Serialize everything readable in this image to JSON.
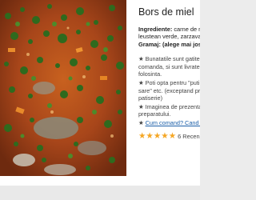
{
  "product": {
    "title": "Bors de miel",
    "ingredients_label": "Ingrediente:",
    "ingredients_line1": " carne de mie",
    "ingredients_line2": "leustean verde, zarzavat, c",
    "gramaj_label": "Gramaj: (alege mai jos)"
  },
  "notes": [
    {
      "lines": [
        "Bunatatile sunt gatite sp",
        "comanda, si sunt livrate in",
        "folosinta."
      ]
    },
    {
      "lines": [
        "Poti opta pentru \"putin s",
        "sare\" etc. (exceptand prod",
        "patiserie)"
      ]
    },
    {
      "lines": [
        "Imaginea de prezentare",
        "preparatului."
      ]
    }
  ],
  "links": {
    "how_to_order": "Cum comand? Cand aju"
  },
  "rating": {
    "stars": 5,
    "reviews_text": "6 Recenzii"
  },
  "colors": {
    "star": "#f5a623",
    "link": "#1a5ea8"
  },
  "icons": {
    "bullet": "star-bullet-icon",
    "rating_star": "star-icon"
  }
}
